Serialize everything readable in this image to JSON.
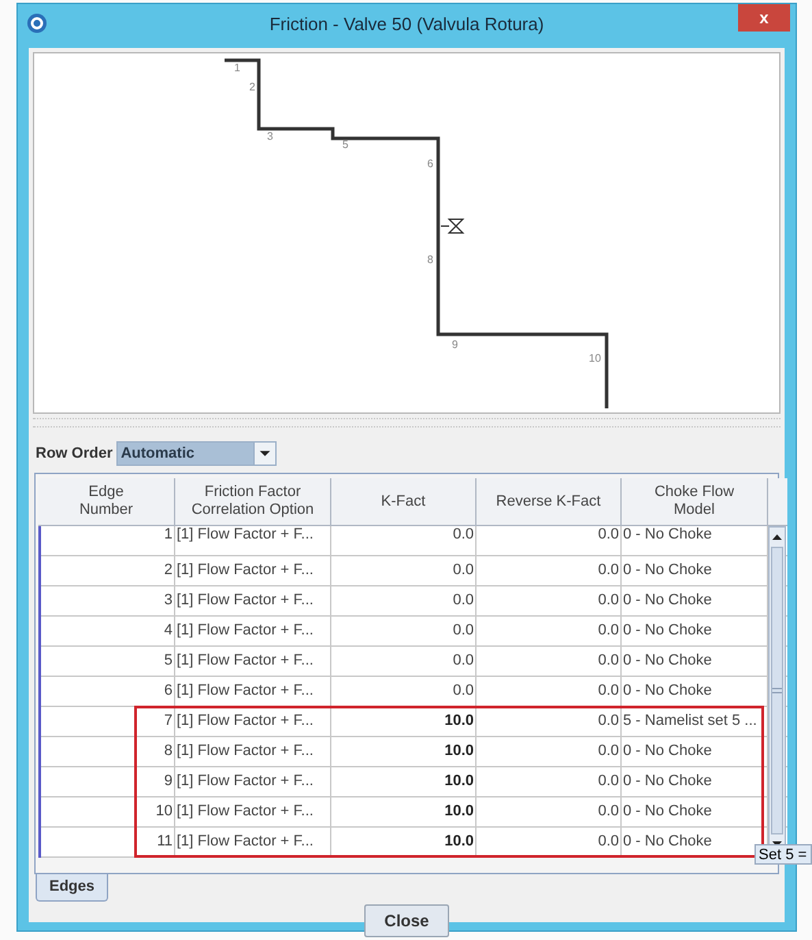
{
  "window": {
    "title": "Friction - Valve 50 (Valvula Rotura)",
    "close_glyph": "x"
  },
  "diagram": {
    "node_labels": [
      "1",
      "2",
      "3",
      "5",
      "6",
      "8",
      "9",
      "10"
    ]
  },
  "row_order": {
    "label": "Row Order",
    "value": "Automatic"
  },
  "table": {
    "columns": [
      "Edge Number",
      "Friction Factor Correlation Option",
      "K-Fact",
      "Reverse K-Fact",
      "Choke Flow Model"
    ],
    "rows": [
      {
        "cells": [
          "1",
          "[1] Flow Factor + F...",
          "0.0",
          "0.0",
          "0 - No Choke"
        ],
        "edited": false,
        "highlighted": false
      },
      {
        "cells": [
          "2",
          "[1] Flow Factor + F...",
          "0.0",
          "0.0",
          "0 - No Choke"
        ],
        "edited": false,
        "highlighted": false
      },
      {
        "cells": [
          "3",
          "[1] Flow Factor + F...",
          "0.0",
          "0.0",
          "0 - No Choke"
        ],
        "edited": false,
        "highlighted": false
      },
      {
        "cells": [
          "4",
          "[1] Flow Factor + F...",
          "0.0",
          "0.0",
          "0 - No Choke"
        ],
        "edited": false,
        "highlighted": false
      },
      {
        "cells": [
          "5",
          "[1] Flow Factor + F...",
          "0.0",
          "0.0",
          "0 - No Choke"
        ],
        "edited": false,
        "highlighted": false
      },
      {
        "cells": [
          "6",
          "[1] Flow Factor + F...",
          "0.0",
          "0.0",
          "0 - No Choke"
        ],
        "edited": false,
        "highlighted": false
      },
      {
        "cells": [
          "7",
          "[1] Flow Factor + F...",
          "10.0",
          "0.0",
          "5 - Namelist set 5 ..."
        ],
        "edited": true,
        "highlighted": true
      },
      {
        "cells": [
          "8",
          "[1] Flow Factor + F...",
          "10.0",
          "0.0",
          "0 - No Choke"
        ],
        "edited": true,
        "highlighted": true
      },
      {
        "cells": [
          "9",
          "[1] Flow Factor + F...",
          "10.0",
          "0.0",
          "0 - No Choke"
        ],
        "edited": true,
        "highlighted": true
      },
      {
        "cells": [
          "10",
          "[1] Flow Factor + F...",
          "10.0",
          "0.0",
          "0 - No Choke"
        ],
        "edited": true,
        "highlighted": true
      },
      {
        "cells": [
          "11",
          "[1] Flow Factor + F...",
          "10.0",
          "0.0",
          "0 - No Choke"
        ],
        "edited": true,
        "highlighted": true
      }
    ]
  },
  "tabs": [
    {
      "label": "Edges",
      "selected": true
    }
  ],
  "tooltip": "Set 5 =",
  "buttons": [
    "Close"
  ]
}
